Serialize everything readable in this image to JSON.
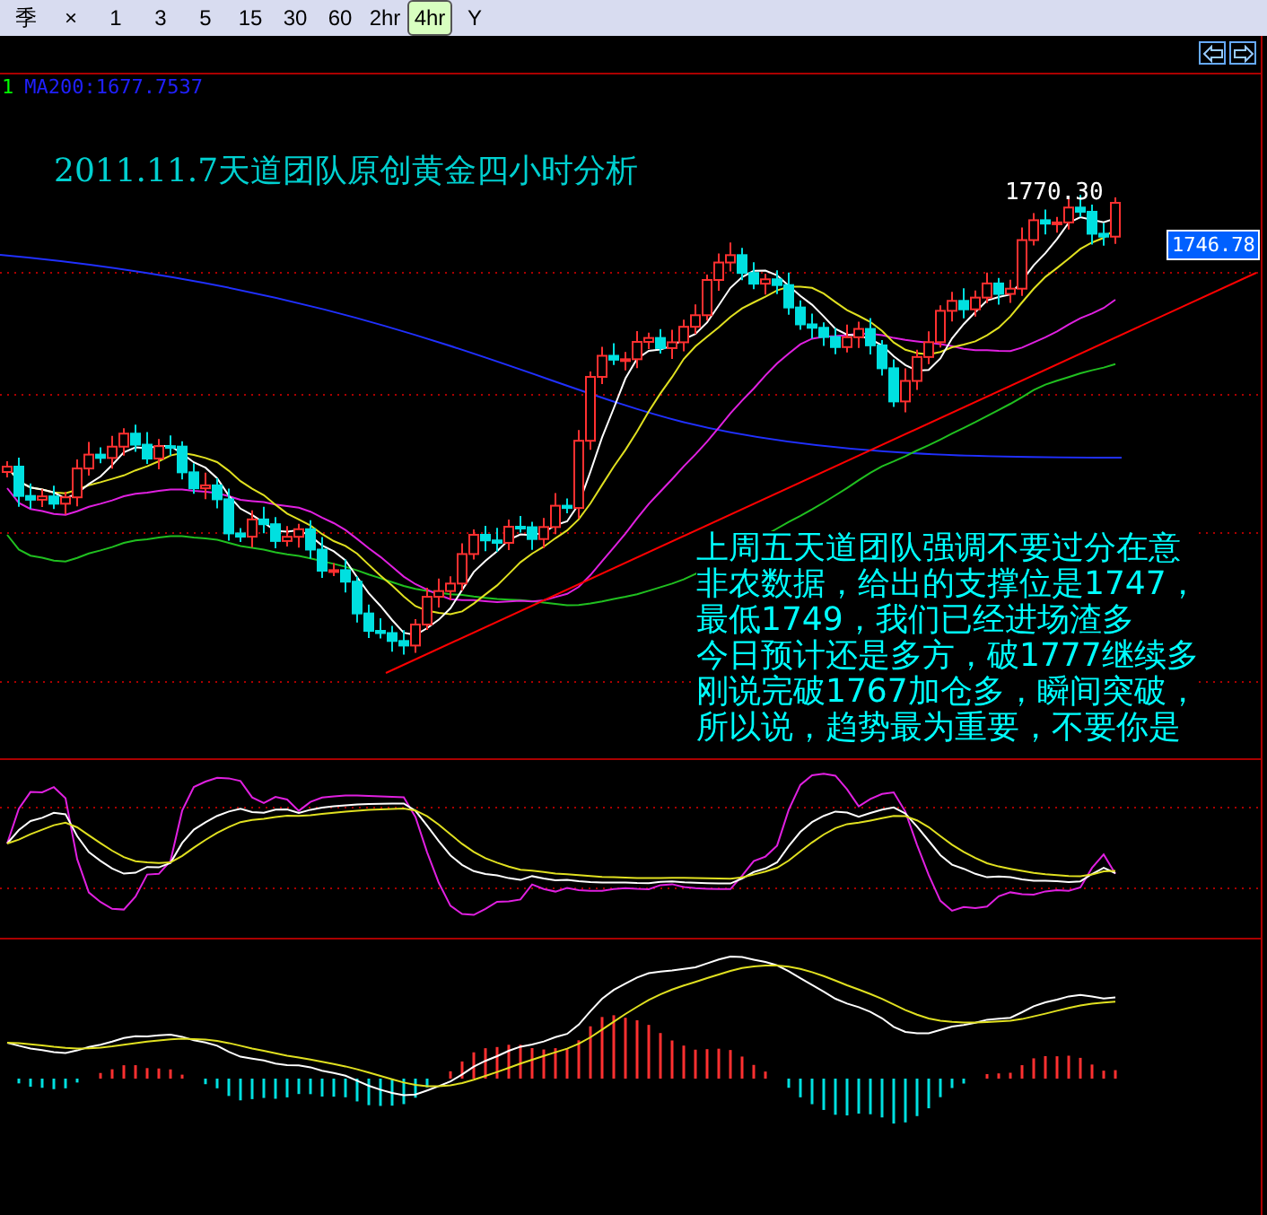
{
  "toolbar": {
    "buttons": [
      {
        "label": "季",
        "selected": false
      },
      {
        "label": "×",
        "selected": false
      },
      {
        "label": "1",
        "selected": false
      },
      {
        "label": "3",
        "selected": false
      },
      {
        "label": "5",
        "selected": false
      },
      {
        "label": "15",
        "selected": false
      },
      {
        "label": "30",
        "selected": false
      },
      {
        "label": "60",
        "selected": false
      },
      {
        "label": "2hr",
        "selected": false
      },
      {
        "label": "4hr",
        "selected": true
      },
      {
        "label": "Y",
        "selected": false
      }
    ]
  },
  "legend": {
    "index": "1",
    "indicator": "MA200:1677.7537"
  },
  "chart": {
    "title": "2011.11.7天道团队原创黄金四小时分析",
    "high_label": "1770.30",
    "price_label": "1746.78"
  },
  "annotation": {
    "lines": [
      "上周五天道团队强调不要过分在意",
      "非农数据，给出的支撑位是1747，",
      "最低1749，我们已经进场渣多",
      "今日预计还是多方，破1777继续多",
      "刚说完破1767加仓多，瞬间突破，",
      "所以说，趋势最为重要，不要你是"
    ]
  }
}
